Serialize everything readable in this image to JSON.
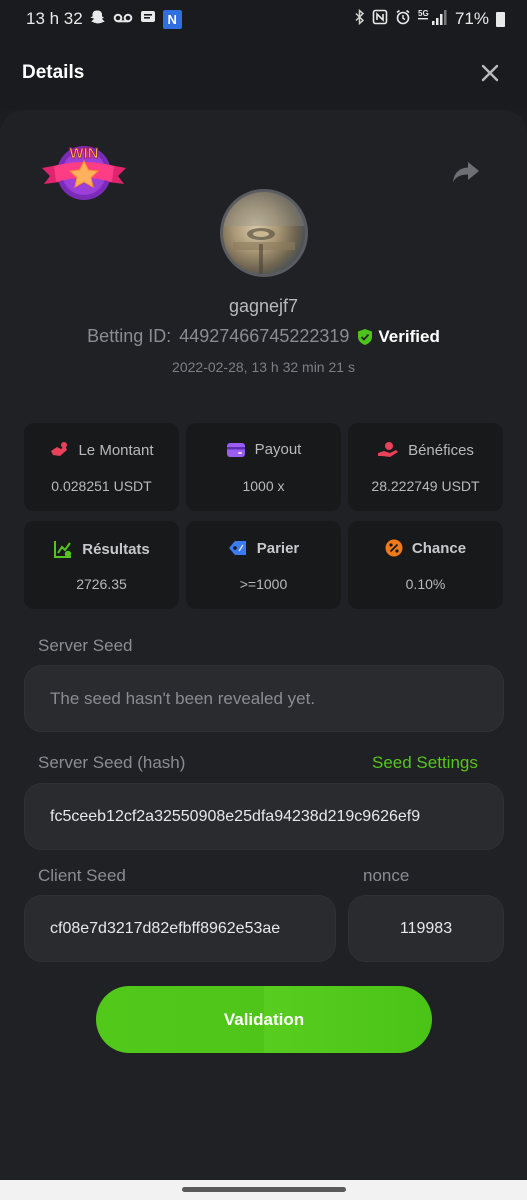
{
  "status_bar": {
    "time": "13 h 32",
    "battery": "71%"
  },
  "header": {
    "title": "Details",
    "close_icon": "close-icon"
  },
  "badge": {
    "text": "WIN"
  },
  "profile": {
    "username": "gagnejf7",
    "betting_id_label": "Betting ID:",
    "betting_id": "44927466745222319",
    "verified_label": "Verified",
    "timestamp": "2022-02-28, 13 h 32 min 21 s"
  },
  "stats": [
    {
      "label": "Le Montant",
      "value": "0.028251 USDT",
      "icon": "amount-icon",
      "color": "#e8415a"
    },
    {
      "label": "Payout",
      "value": "1000 x",
      "icon": "wallet-icon",
      "color": "#9b5cf2"
    },
    {
      "label": "Bénéfices",
      "value": "28.222749 USDT",
      "icon": "profit-icon",
      "color": "#e8415a"
    },
    {
      "label": "Résultats",
      "value": "2726.35",
      "icon": "chart-icon",
      "color": "#55c51e"
    },
    {
      "label": "Parier",
      "value": ">=1000",
      "icon": "tag-icon",
      "color": "#3a7bf0"
    },
    {
      "label": "Chance",
      "value": "0.10%",
      "icon": "percent-icon",
      "color": "#f07a1a"
    }
  ],
  "seeds": {
    "server_seed_label": "Server Seed",
    "server_seed_placeholder": "The seed hasn't been revealed yet.",
    "server_seed_hash_label": "Server Seed (hash)",
    "seed_settings_label": "Seed Settings",
    "server_seed_hash": "fc5ceeb12cf2a32550908e25dfa94238d219c9626ef9",
    "client_seed_label": "Client Seed",
    "client_seed": "cf08e7d3217d82efbff8962e53ae",
    "nonce_label": "nonce",
    "nonce": "119983"
  },
  "actions": {
    "validate_label": "Validation"
  },
  "colors": {
    "accent": "#55c51e",
    "background": "#202124"
  }
}
